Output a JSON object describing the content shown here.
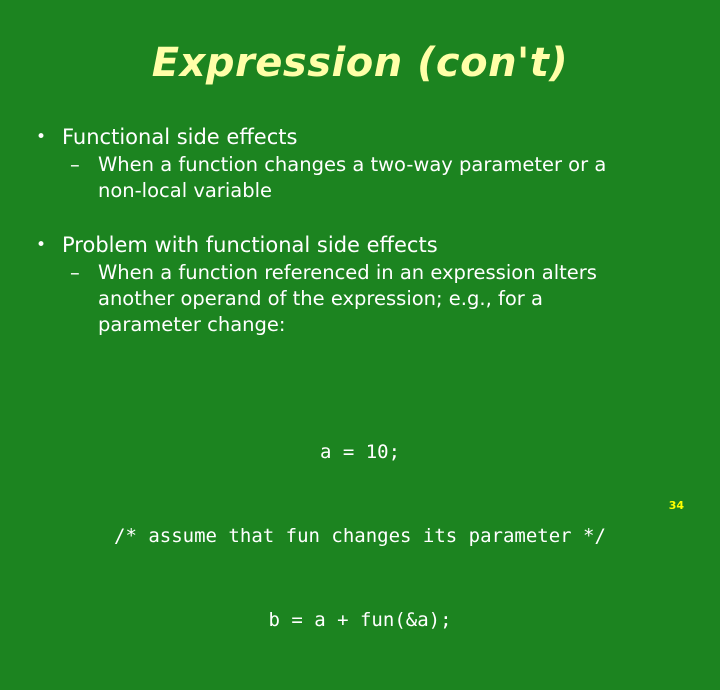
{
  "slide": {
    "title": "Expression (con't)",
    "background_color": "#1c8420",
    "title_color": "#ffffa8",
    "body_color": "#ffffff",
    "number_color": "#ffff00",
    "number": "34"
  },
  "bullets": [
    {
      "marker": "•",
      "text": "Functional side effects",
      "sub": [
        {
          "marker": "–",
          "lines": [
            "When a function changes a two-way parameter or a",
            "non-local variable"
          ]
        }
      ]
    },
    {
      "marker": "•",
      "text": "Problem with functional side effects",
      "sub": [
        {
          "marker": "–",
          "lines": [
            "When a function referenced in an expression alters",
            "another operand of the expression; e.g., for a",
            "parameter change:"
          ]
        }
      ]
    }
  ],
  "code": {
    "lines": [
      "a = 10;",
      "/* assume that fun changes its parameter */",
      "b = a + fun(&a);"
    ]
  }
}
